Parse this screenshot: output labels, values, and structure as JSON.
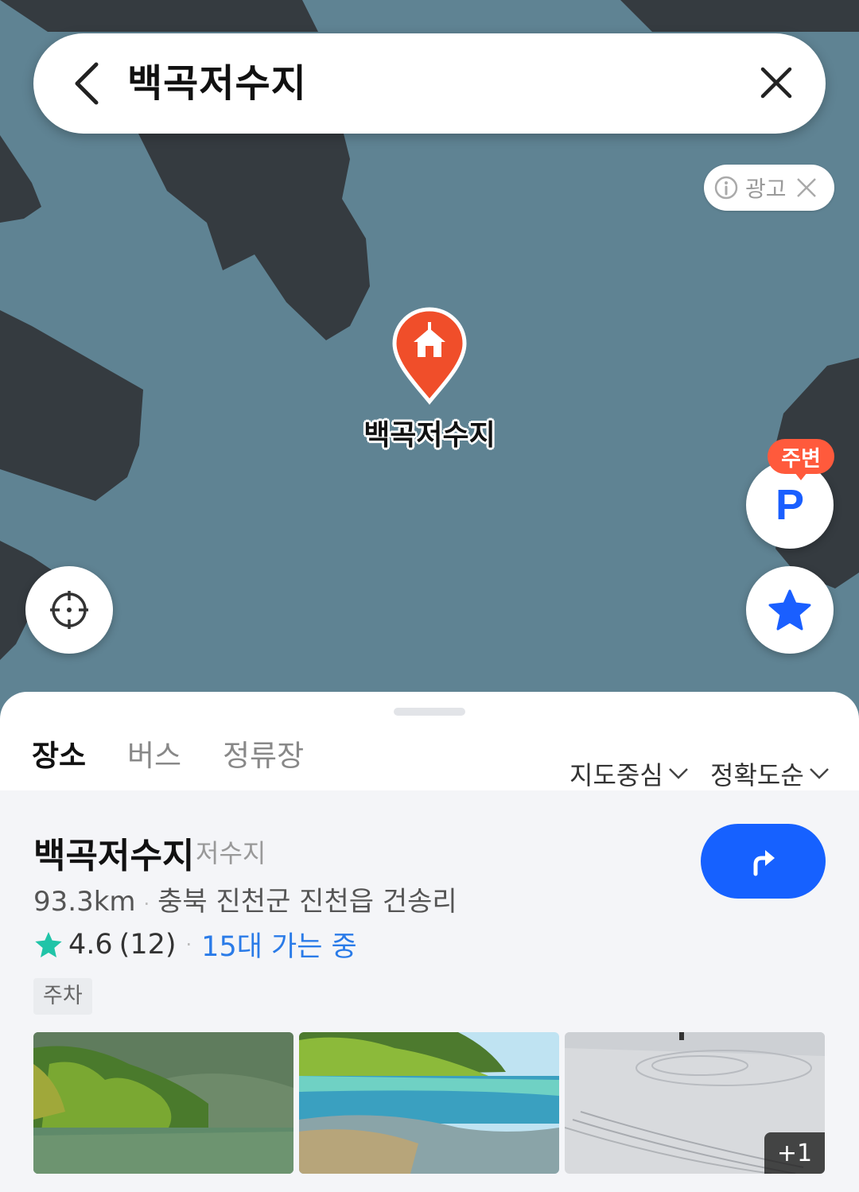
{
  "search": {
    "query": "백곡저수지"
  },
  "map": {
    "ad_label": "광고",
    "pin_label": "백곡저수지",
    "parking_badge": "주변",
    "parking_letter": "P",
    "colors": {
      "water": "#5f8393",
      "land": "#353b40",
      "pin": "#f04e2a",
      "accent": "#1661ff"
    }
  },
  "tabs": [
    {
      "label": "장소",
      "active": true
    },
    {
      "label": "버스",
      "active": false
    },
    {
      "label": "정류장",
      "active": false
    }
  ],
  "sort": {
    "area": "지도중심",
    "order": "정확도순"
  },
  "result": {
    "name": "백곡저수지",
    "category": "저수지",
    "distance": "93.3km",
    "address": "충북 진천군 진천읍 건송리",
    "rating": "4.6",
    "review_count": "(12)",
    "going": "15대 가는 중",
    "tag": "주차",
    "more_photos": "+1"
  }
}
